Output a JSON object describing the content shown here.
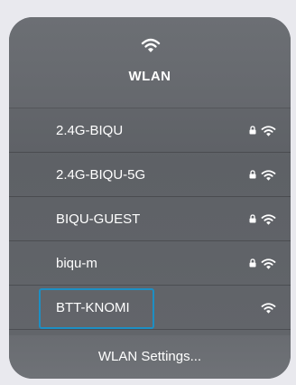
{
  "header": {
    "icon": "wifi-icon",
    "title": "WLAN"
  },
  "networks": [
    {
      "name": "2.4G-BIQU",
      "locked": true,
      "icon": "wifi-icon"
    },
    {
      "name": "2.4G-BIQU-5G",
      "locked": true,
      "icon": "wifi-icon"
    },
    {
      "name": "BIQU-GUEST",
      "locked": true,
      "icon": "wifi-icon"
    },
    {
      "name": "biqu-m",
      "locked": true,
      "icon": "wifi-icon"
    },
    {
      "name": "BTT-KNOMI",
      "locked": false,
      "icon": "wifi-icon",
      "highlighted": true
    }
  ],
  "footer": {
    "settings_label": "WLAN Settings..."
  },
  "colors": {
    "panel": "#626569",
    "text": "#ffffff",
    "highlight_border": "#1d8fc4",
    "background": "#e9e9ee"
  }
}
